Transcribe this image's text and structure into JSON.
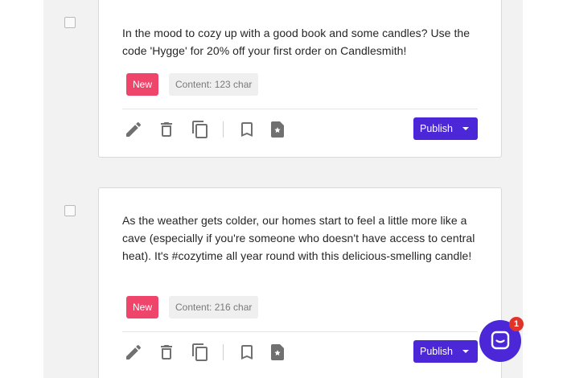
{
  "posts": [
    {
      "text": "In the mood to cozy up with a good book and some candles? Use the code 'Hygge' for 20% off your first order on Candlesmith!",
      "status_badge": "New",
      "content_count": "Content: 123 char",
      "publish_label": "Publish"
    },
    {
      "text": "As the weather gets colder, our homes start to feel a little more like a cave (especially if you're someone who doesn't have access to central heat). It's #cozytime all year round with this delicious-smelling candle!",
      "status_badge": "New",
      "content_count": "Content: 216 char",
      "publish_label": "Publish"
    }
  ],
  "chat": {
    "unread_count": "1"
  },
  "icons": {
    "edit": "pencil-icon",
    "delete": "trash-icon",
    "duplicate": "copy-icon",
    "bookmark": "bookmark-icon",
    "favorite": "star-document-icon",
    "chat": "chat-icon"
  },
  "colors": {
    "publish_button": "#4b27d8",
    "new_badge": "#f0456b",
    "chat_badge": "#e0342a"
  }
}
